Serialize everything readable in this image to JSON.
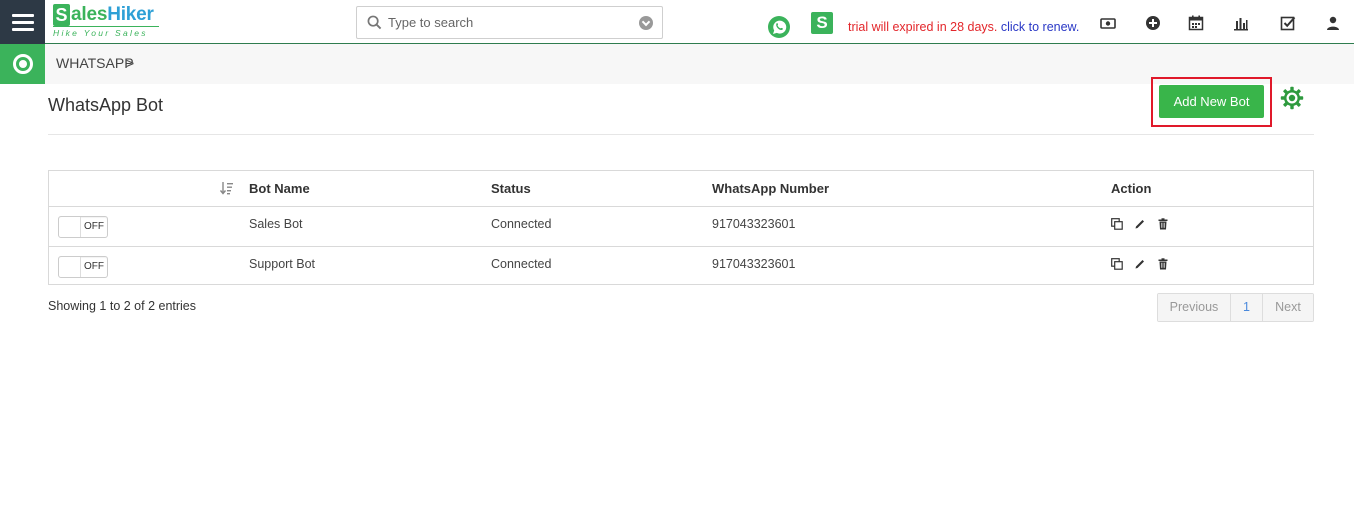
{
  "app": {
    "logo_s": "S",
    "logo_text_green": "ales",
    "logo_text_blue": "Hiker",
    "tagline": "Hike Your Sales"
  },
  "search": {
    "placeholder": "Type to search"
  },
  "notice": {
    "text": "trial will expired in 28 days.",
    "link": "click to renew."
  },
  "breadcrumb": {
    "label": "WHATSAPP",
    "chevron": ">"
  },
  "page": {
    "title": "WhatsApp Bot",
    "add_button": "Add New Bot"
  },
  "table": {
    "headers": [
      "Bot Name",
      "Status",
      "WhatsApp Number",
      "Action"
    ],
    "rows": [
      {
        "toggle": "OFF",
        "name": "Sales Bot",
        "status": "Connected",
        "number": "917043323601"
      },
      {
        "toggle": "OFF",
        "name": "Support Bot",
        "status": "Connected",
        "number": "917043323601"
      }
    ]
  },
  "footer": {
    "showing": "Showing 1 to 2 of 2 entries",
    "previous": "Previous",
    "page": "1",
    "next": "Next"
  },
  "colors": {
    "brand_green": "#39b54a",
    "dark_nav": "#2d3945",
    "alert_red": "#e3262b",
    "link_blue": "#2a38c6"
  }
}
